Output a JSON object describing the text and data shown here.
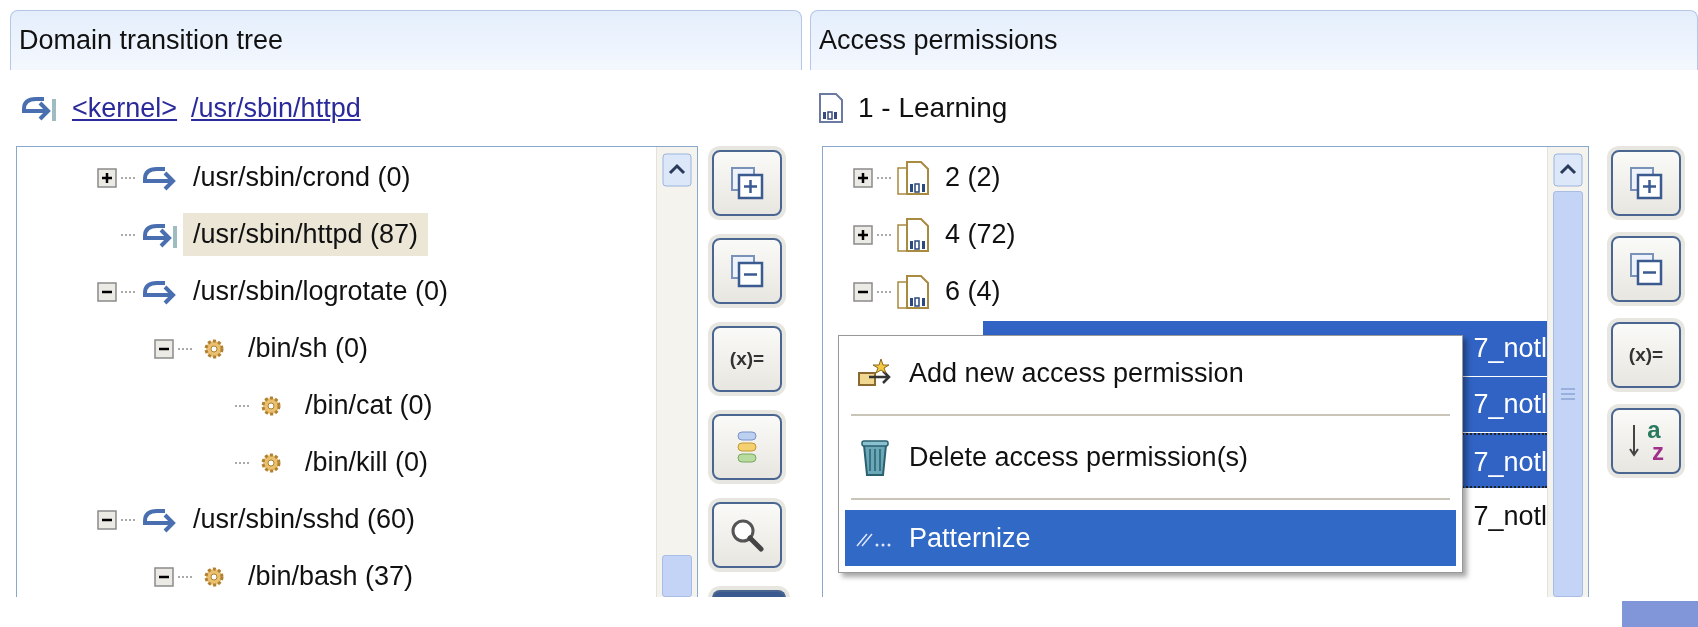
{
  "left_panel": {
    "title": "Domain transition tree",
    "breadcrumb": [
      "<kernel>",
      "/usr/sbin/httpd"
    ],
    "tree": [
      {
        "label": "/usr/sbin/crond (0)",
        "kind": "domain",
        "expanded": false,
        "selected": false
      },
      {
        "label": "/usr/sbin/httpd (87)",
        "kind": "current-domain",
        "selected": true
      },
      {
        "label": "/usr/sbin/logrotate (0)",
        "kind": "domain",
        "expanded": true,
        "selected": false,
        "children": [
          {
            "label": "/bin/sh (0)",
            "kind": "process",
            "expanded": true,
            "selected": false,
            "children": [
              {
                "label": "/bin/cat (0)",
                "kind": "process",
                "selected": false
              },
              {
                "label": "/bin/kill (0)",
                "kind": "process",
                "selected": false
              }
            ]
          }
        ]
      },
      {
        "label": "/usr/sbin/sshd (60)",
        "kind": "domain",
        "expanded": true,
        "selected": false,
        "children": [
          {
            "label": "/bin/bash (37)",
            "kind": "process",
            "expanded": true,
            "selected": false
          }
        ]
      }
    ],
    "toolbar": [
      {
        "kind": "expand-all"
      },
      {
        "kind": "collapse-all"
      },
      {
        "kind": "variables",
        "label": "(x)="
      },
      {
        "kind": "layers"
      },
      {
        "kind": "search"
      }
    ]
  },
  "right_panel": {
    "title": "Access permissions",
    "profile": "1 - Learning",
    "tree": [
      {
        "label": "2 (2)",
        "kind": "group",
        "expanded": false
      },
      {
        "label": "4 (72)",
        "kind": "group",
        "expanded": false
      },
      {
        "label": "6 (4)",
        "kind": "group",
        "expanded": true,
        "children": [
          {
            "label": "7_notl",
            "kind": "permission",
            "selected": true,
            "focused": false
          },
          {
            "label": "7_notl",
            "kind": "permission",
            "selected": true,
            "focused": false
          },
          {
            "label": "7_notl",
            "kind": "permission",
            "selected": true,
            "focused": true
          },
          {
            "label": "7_notl",
            "kind": "permission",
            "selected": false,
            "focused": false
          }
        ]
      }
    ],
    "toolbar": [
      {
        "kind": "expand-all"
      },
      {
        "kind": "collapse-all"
      },
      {
        "kind": "variables",
        "label": "(x)="
      },
      {
        "kind": "sort",
        "label_top": "a",
        "label_bottom": "z"
      }
    ],
    "context_menu": [
      {
        "kind": "add",
        "label": "Add new access permission",
        "selected": false
      },
      {
        "kind": "separator"
      },
      {
        "kind": "delete",
        "label": "Delete access permission(s)",
        "selected": false
      },
      {
        "kind": "separator"
      },
      {
        "kind": "pattern",
        "label": "Patternize",
        "selected": true
      }
    ]
  }
}
